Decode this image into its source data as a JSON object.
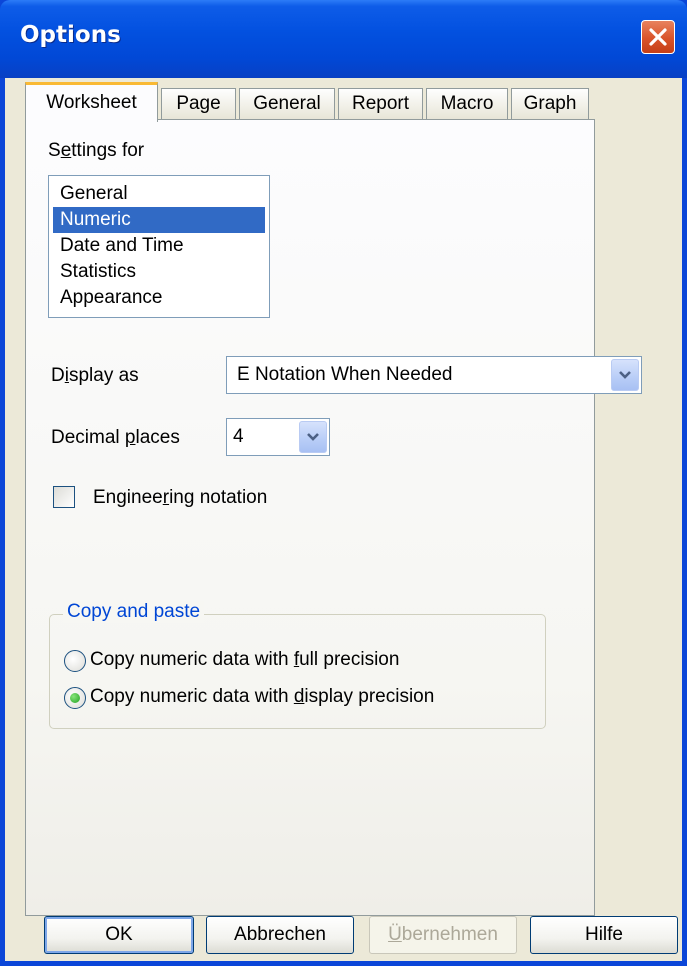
{
  "window": {
    "title": "Options",
    "close_label": "✕"
  },
  "tabs": [
    {
      "label": "Worksheet",
      "active": true
    },
    {
      "label": "Page",
      "active": false
    },
    {
      "label": "General",
      "active": false
    },
    {
      "label": "Report",
      "active": false
    },
    {
      "label": "Macro",
      "active": false
    },
    {
      "label": "Graph",
      "active": false
    }
  ],
  "settings_for": {
    "label_pre": "S",
    "label_u": "e",
    "label_post": "ttings for",
    "items": [
      {
        "label": "General",
        "selected": false
      },
      {
        "label": "Numeric",
        "selected": true
      },
      {
        "label": "Date and Time",
        "selected": false
      },
      {
        "label": "Statistics",
        "selected": false
      },
      {
        "label": "Appearance",
        "selected": false
      }
    ]
  },
  "display_as": {
    "label_pre": "D",
    "label_u": "i",
    "label_post": "splay as",
    "value": "E Notation When Needed"
  },
  "decimal_places": {
    "label_pre": "Decimal ",
    "label_u": "p",
    "label_post": "laces",
    "value": "4"
  },
  "engineering": {
    "label_pre": "Enginee",
    "label_u": "r",
    "label_post": "ing notation",
    "checked": false
  },
  "copy_paste": {
    "legend": "Copy and paste",
    "options": [
      {
        "label_pre": "Copy numeric data with ",
        "label_u": "f",
        "label_post": "ull precision",
        "selected": false
      },
      {
        "label_pre": "Copy numeric data with ",
        "label_u": "d",
        "label_post": "isplay precision",
        "selected": true
      }
    ]
  },
  "buttons": {
    "ok": "OK",
    "cancel": "Abbrechen",
    "apply_u": "Ü",
    "apply_post": "bernehmen",
    "help": "Hilfe"
  },
  "colors": {
    "title_bar": "#0351e0",
    "selection": "#316ac5",
    "group_label": "#0046d5",
    "active_tab_accent": "#f9b934"
  }
}
